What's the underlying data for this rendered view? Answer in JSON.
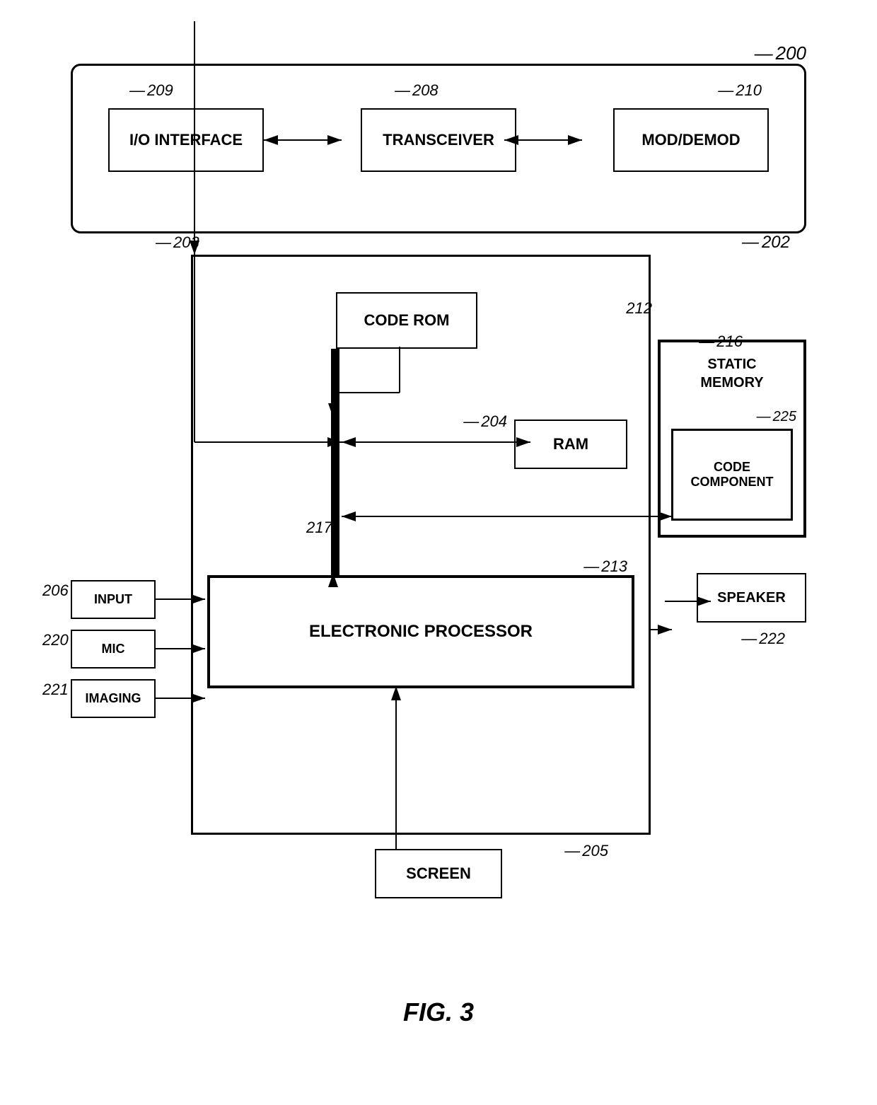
{
  "figure": {
    "label": "FIG. 3",
    "ref_main": "200",
    "ref_outer_box": "202",
    "ref_subsystem": "203"
  },
  "top_section": {
    "ref_io": "209",
    "ref_transceiver": "208",
    "ref_moddemod": "210",
    "io_label": "I/O INTERFACE",
    "transceiver_label": "TRANSCEIVER",
    "moddemod_label": "MOD/DEMOD"
  },
  "main_section": {
    "code_rom": {
      "label": "CODE ROM",
      "ref": "212"
    },
    "ram": {
      "label": "RAM",
      "ref": "204"
    },
    "processor": {
      "label": "ELECTRONIC PROCESSOR",
      "ref": "213"
    },
    "bus_ref": "217",
    "static_memory": {
      "label": "STATIC\nMEMORY",
      "ref": "216"
    },
    "code_component": {
      "label": "CODE\nCOMPONENT",
      "ref": "225"
    },
    "speaker": {
      "label": "SPEAKER",
      "ref": "222"
    },
    "input": {
      "label": "INPUT",
      "ref": "206"
    },
    "mic": {
      "label": "MIC",
      "ref": "220"
    },
    "imaging": {
      "label": "IMAGING",
      "ref": "221"
    },
    "screen": {
      "label": "SCREEN",
      "ref": "205"
    }
  }
}
